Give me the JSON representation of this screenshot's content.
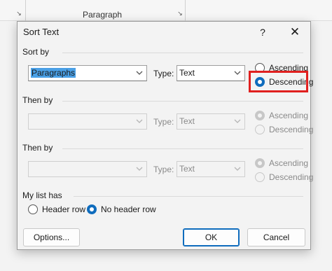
{
  "ribbon": {
    "group_label": "Paragraph"
  },
  "dialog": {
    "title": "Sort Text",
    "help_icon": "?",
    "close_icon": "✕",
    "sort_by": {
      "label": "Sort by",
      "field_value": "Paragraphs",
      "type_label": "Type:",
      "type_value": "Text",
      "ascending_label": "Ascending",
      "descending_label": "Descending",
      "selected": "descending"
    },
    "then_by_1": {
      "label": "Then by",
      "field_value": "",
      "type_label": "Type:",
      "type_value": "Text",
      "ascending_label": "Ascending",
      "descending_label": "Descending",
      "enabled": false
    },
    "then_by_2": {
      "label": "Then by",
      "field_value": "",
      "type_label": "Type:",
      "type_value": "Text",
      "ascending_label": "Ascending",
      "descending_label": "Descending",
      "enabled": false
    },
    "my_list_has": {
      "label": "My list has",
      "header_row_label": "Header row",
      "no_header_row_label": "No header row",
      "selected": "no_header_row"
    },
    "buttons": {
      "options": "Options...",
      "ok": "OK",
      "cancel": "Cancel"
    }
  },
  "colors": {
    "accent": "#0f6cbd",
    "highlight_box": "#e0201f",
    "selection": "#4aa0e6"
  }
}
